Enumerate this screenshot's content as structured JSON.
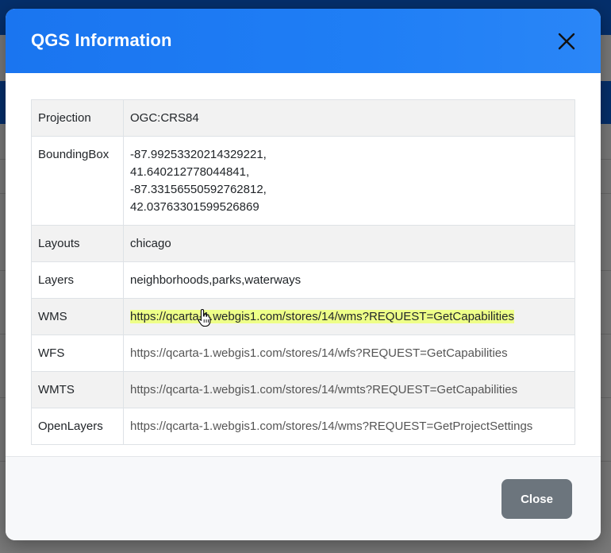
{
  "modal": {
    "title": "QGS Information",
    "close_label": "Close"
  },
  "info_table": {
    "rows": [
      {
        "key": "Projection",
        "value": "OGC:CRS84"
      },
      {
        "key": "BoundingBox",
        "values": [
          "-87.99253320214329221,",
          "41.640212778044841,",
          "-87.33156550592762812,",
          "42.03763301599526869"
        ]
      },
      {
        "key": "Layouts",
        "value": "chicago"
      },
      {
        "key": "Layers",
        "value": "neighborhoods,parks,waterways"
      },
      {
        "key": "WMS",
        "value": "https://qcarta-1.webgis1.com/stores/14/wms?REQUEST=GetCapabilities"
      },
      {
        "key": "WFS",
        "value": "https://qcarta-1.webgis1.com/stores/14/wfs?REQUEST=GetCapabilities"
      },
      {
        "key": "WMTS",
        "value": "https://qcarta-1.webgis1.com/stores/14/wmts?REQUEST=GetCapabilities"
      },
      {
        "key": "OpenLayers",
        "value": "https://qcarta-1.webgis1.com/stores/14/wms?REQUEST=GetProjectSettings"
      }
    ]
  },
  "colors": {
    "header_blue": "#1a75f0",
    "link_highlight": "#eeff88",
    "close_button": "#6c757d"
  },
  "icons": {
    "close": "close-icon",
    "cursor": "hand-pointer-icon"
  }
}
